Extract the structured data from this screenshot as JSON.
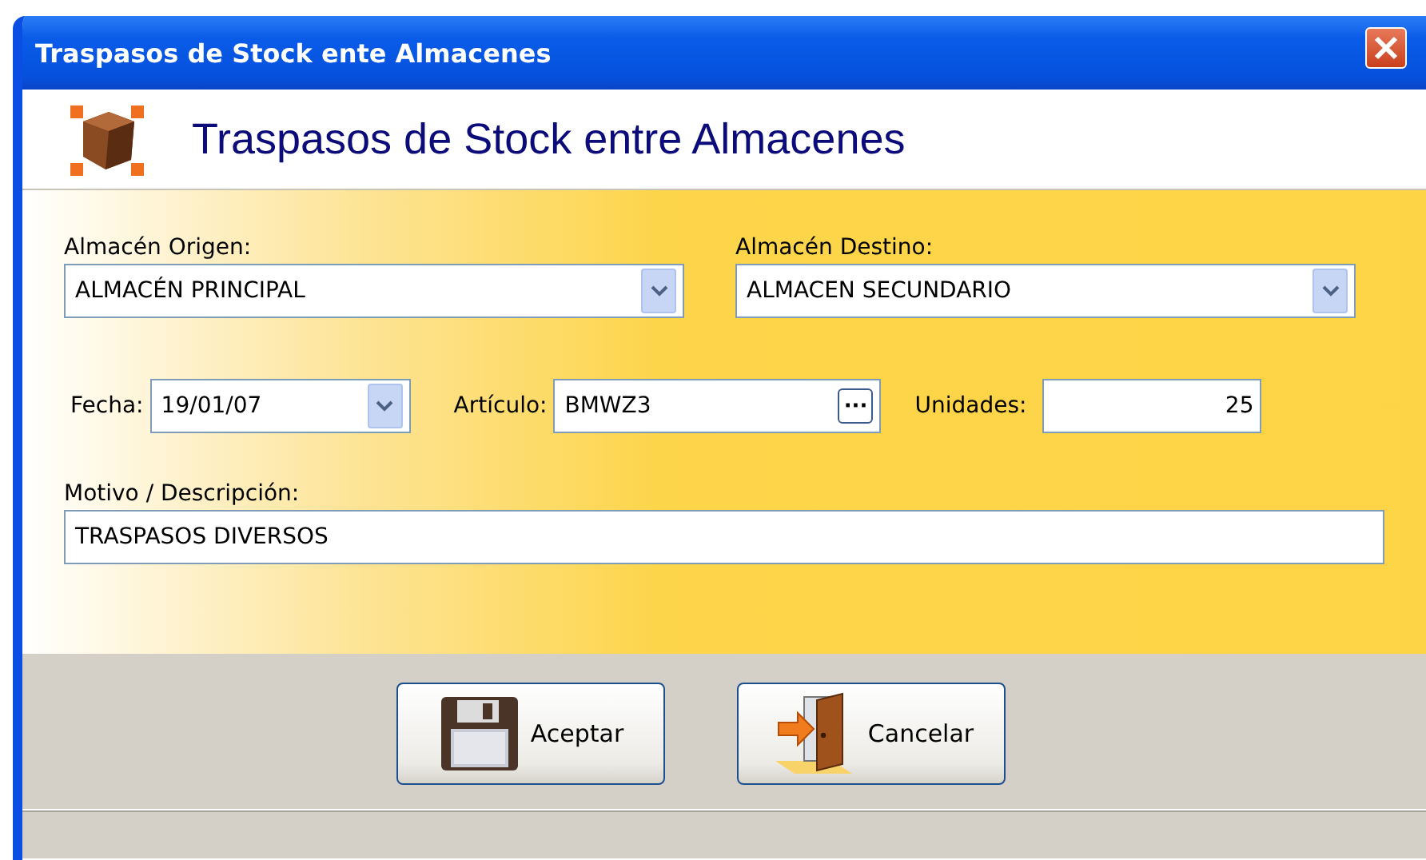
{
  "window": {
    "title": "Traspasos de Stock ente Almacenes"
  },
  "header": {
    "title": "Traspasos de Stock entre Almacenes"
  },
  "origin": {
    "label": "Almacén Origen:",
    "value": "ALMACÉN PRINCIPAL"
  },
  "destination": {
    "label": "Almacén Destino:",
    "value": "ALMACEN SECUNDARIO"
  },
  "date": {
    "label": "Fecha:",
    "value": "19/01/07"
  },
  "article": {
    "label": "Artículo:",
    "value": "BMWZ3",
    "browse": "···"
  },
  "units": {
    "label": "Unidades:",
    "value": "25"
  },
  "reason": {
    "label": "Motivo / Descripción:",
    "value": "TRASPASOS DIVERSOS"
  },
  "buttons": [
    {
      "label": "Aceptar",
      "kind": "save"
    },
    {
      "label": "Cancelar",
      "kind": "exit"
    }
  ]
}
